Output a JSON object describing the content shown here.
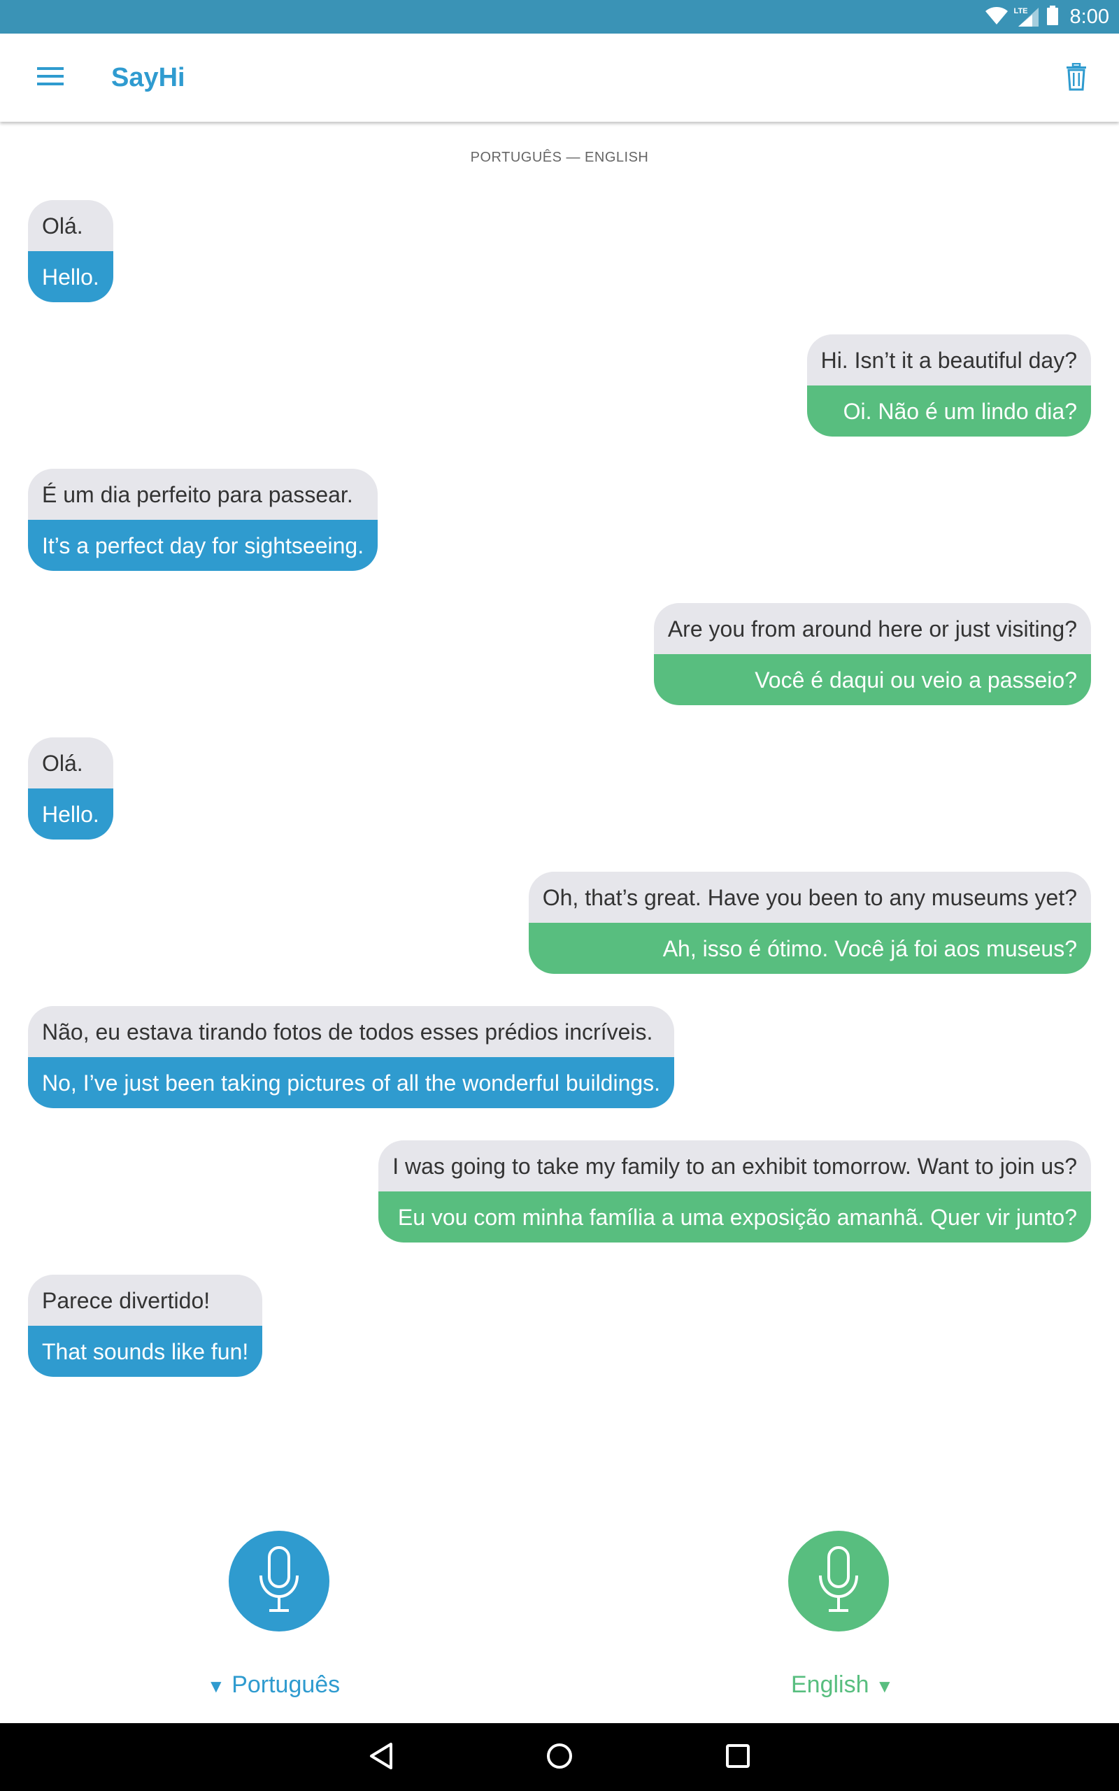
{
  "status_bar": {
    "time": "8:00",
    "network_label": "LTE",
    "icons": [
      "wifi-icon",
      "cell-signal-icon",
      "battery-icon"
    ]
  },
  "app_bar": {
    "title": "SayHi",
    "menu_icon": "menu-icon",
    "trash_icon": "trash-icon"
  },
  "conversation": {
    "language_pair": "PORTUGUÊS — ENGLISH",
    "messages": [
      {
        "speaker": "left",
        "original": "Olá.",
        "translation": "Hello."
      },
      {
        "speaker": "right",
        "original": "Hi. Isn’t it a beautiful day?",
        "translation": "Oi. Não é um lindo dia?"
      },
      {
        "speaker": "left",
        "original": "É um dia perfeito para passear.",
        "translation": "It’s a perfect day for sightseeing."
      },
      {
        "speaker": "right",
        "original": "Are you from around here or just visiting?",
        "translation": "Você é daqui ou veio a passeio?"
      },
      {
        "speaker": "left",
        "original": "Olá.",
        "translation": "Hello."
      },
      {
        "speaker": "right",
        "original": "Oh, that’s great. Have you been to any museums yet?",
        "translation": "Ah, isso é ótimo. Você já foi aos museus?"
      },
      {
        "speaker": "left",
        "original": "Não, eu estava tirando fotos de todos esses prédios incríveis.",
        "translation": "No, I’ve just been taking pictures of all the wonderful buildings."
      },
      {
        "speaker": "right",
        "original": "I was going to take my family to an exhibit tomorrow. Want to join us?",
        "translation": "Eu vou com minha família a uma exposição amanhã. Quer vir junto?"
      },
      {
        "speaker": "left",
        "original": "Parece divertido!",
        "translation": "That sounds like fun!"
      }
    ]
  },
  "controls": {
    "left": {
      "language": "Português",
      "arrow": "▼",
      "icon": "microphone-icon"
    },
    "right": {
      "language": "English",
      "arrow": "▼",
      "icon": "microphone-icon"
    }
  },
  "colors": {
    "status_bar": "#3a93b6",
    "accent_blue": "#2f9bcf",
    "accent_green": "#58be7f",
    "bubble_gray": "#e6e6eb"
  },
  "nav_bar": {
    "icons": [
      "back-icon",
      "home-icon",
      "recents-icon"
    ]
  }
}
